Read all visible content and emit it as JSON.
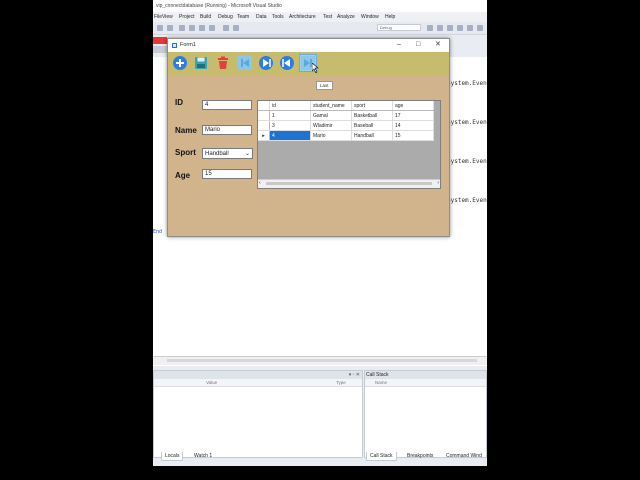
{
  "vs": {
    "title": "vip_connectdatabase (Running) - Microsoft Visual Studio",
    "menu": [
      "File",
      "View",
      "Project",
      "Build",
      "Debug",
      "Team",
      "Data",
      "Tools",
      "Architecture",
      "Test",
      "Analyze",
      "Window",
      "Help"
    ],
    "debug_config": "Debug",
    "code_lines": [
      "System.Even",
      "System.Even",
      "System.Even",
      "System.Even"
    ],
    "end_text": "End",
    "panes": {
      "left_columns": [
        "Value",
        "Type"
      ],
      "right_title": "Call Stack",
      "right_columns": [
        "Name"
      ]
    },
    "bottom_tabs_left": [
      "Locals",
      "Watch 1"
    ],
    "bottom_tabs_right": [
      "Call Stack",
      "Breakpoints",
      "Command Wind"
    ]
  },
  "form": {
    "title": "Form1",
    "tooltip": "Last",
    "labels": {
      "id": "ID",
      "name": "Name",
      "sport": "Sport",
      "age": "Age"
    },
    "values": {
      "id": "4",
      "name": "Mario",
      "sport": "Handball",
      "age": "15"
    },
    "grid": {
      "columns": [
        "id",
        "student_name",
        "sport",
        "age"
      ],
      "rows": [
        {
          "id": "1",
          "student_name": "Gamal",
          "sport": "Basketball",
          "age": "17"
        },
        {
          "id": "3",
          "student_name": "Wladimir",
          "sport": "Baseball",
          "age": "14"
        },
        {
          "id": "4",
          "student_name": "Mario",
          "sport": "Handball",
          "age": "15"
        }
      ],
      "row_marker": "▸"
    }
  },
  "colors": {
    "form_bg": "#d2b48c",
    "toolbar_bg": "#c7bb6d",
    "accent_blue": "#2f7de1",
    "delete_red": "#e0413b"
  }
}
